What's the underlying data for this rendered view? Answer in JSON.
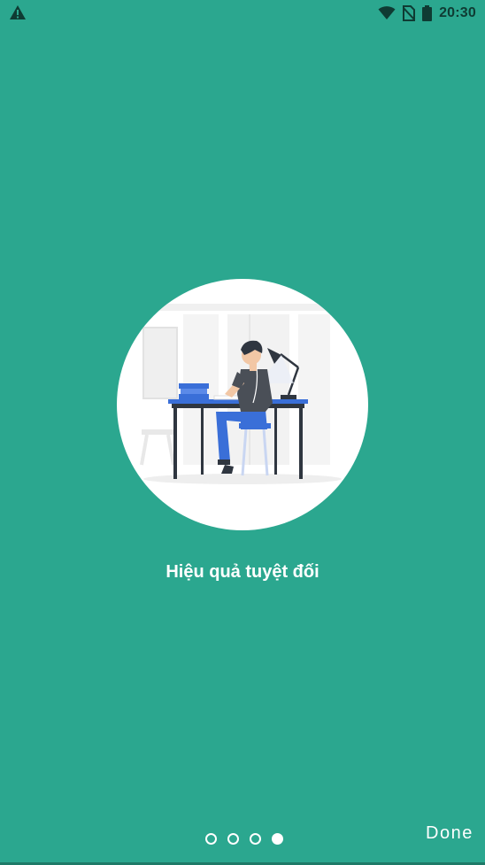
{
  "status_bar": {
    "time": "20:30",
    "left_icon": "warning-icon",
    "right_icons": [
      "wifi-icon",
      "no-sim-icon",
      "battery-icon"
    ]
  },
  "colors": {
    "background": "#2ba78f",
    "accent": "#3a6fd8",
    "text": "#ffffff"
  },
  "slide": {
    "title": "Hiệu quả tuyệt đối",
    "illustration": "person-studying-at-desk-illustration"
  },
  "pagination": {
    "total": 4,
    "current": 4
  },
  "actions": {
    "done_label": "Done"
  }
}
